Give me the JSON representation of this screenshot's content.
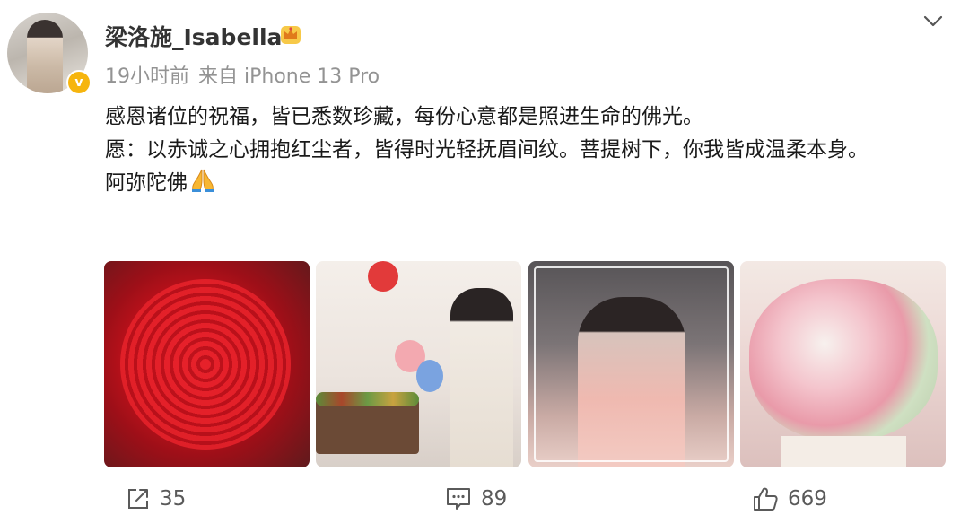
{
  "post": {
    "author": {
      "name": "梁洛施_Isabella",
      "badge_icon": "crown-icon",
      "verified_icon": "verified-v-icon",
      "verified_label": "v",
      "verified_color": "#f6b50e"
    },
    "meta": {
      "time": "19小时前",
      "source": "来自 iPhone 13 Pro"
    },
    "text": {
      "line1": "感恩诸位的祝福，皆已悉数珍藏，每份心意都是照进生命的佛光。",
      "line2": "愿：以赤诚之心拥抱红尘者，皆得时光轻抚眉间纹。菩提树下，你我皆成温柔本身。",
      "line3": "阿弥陀佛",
      "line3_emoji": "folded-hands-icon"
    },
    "photos": [
      {
        "name": "red-roses-bouquet-photo"
      },
      {
        "name": "cake-cutting-photo"
      },
      {
        "name": "birthday-group-photo"
      },
      {
        "name": "pink-flower-box-photo"
      }
    ],
    "actions": {
      "share_count": "35",
      "comment_count": "89",
      "like_count": "669"
    },
    "more_icon": "chevron-down-icon"
  }
}
